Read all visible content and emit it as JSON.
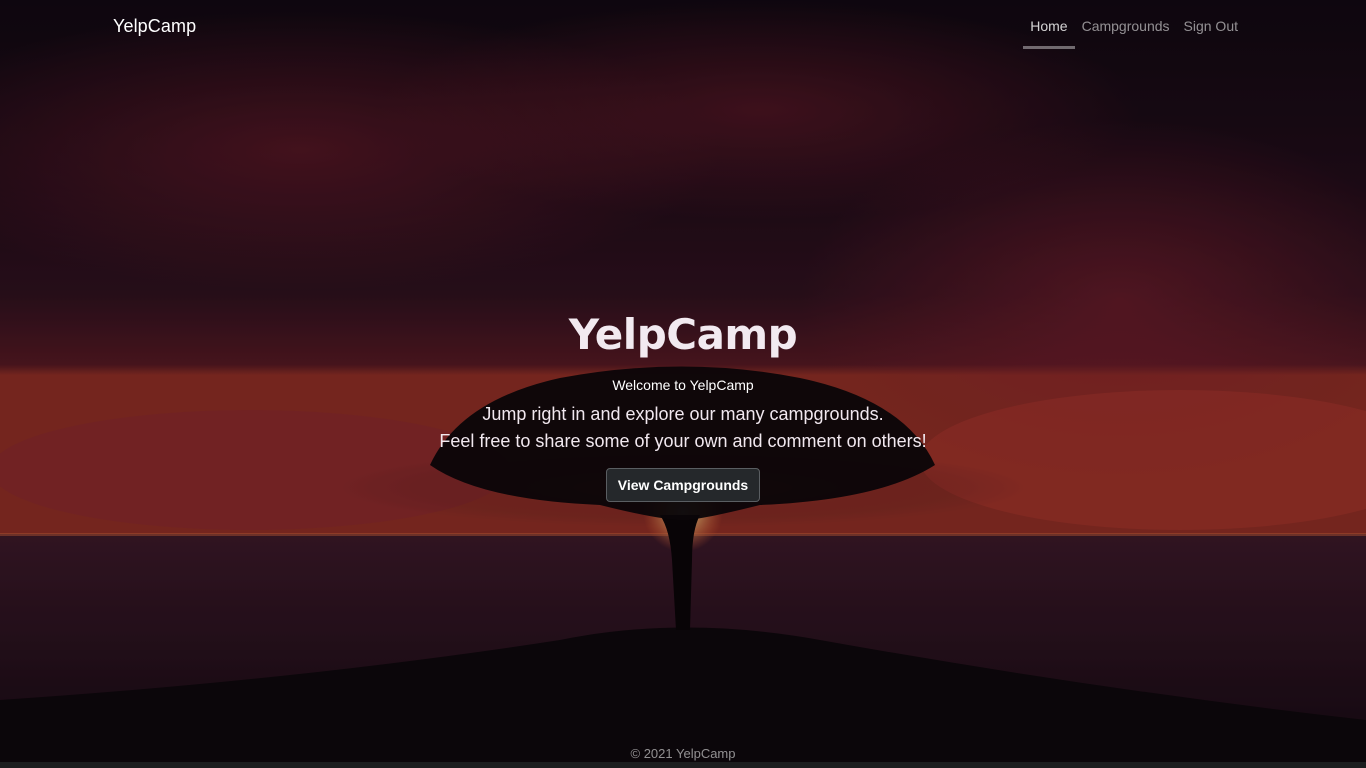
{
  "header": {
    "brand": "YelpCamp",
    "nav": [
      {
        "label": "Home",
        "active": true
      },
      {
        "label": "Campgrounds",
        "active": false
      },
      {
        "label": "Sign Out",
        "active": false
      }
    ]
  },
  "hero": {
    "title": "YelpCamp",
    "welcome": "Welcome to YelpCamp",
    "lead_line1": "Jump right in and explore our many campgrounds.",
    "lead_line2": "Feel free to share some of your own and comment on others!",
    "button_label": "View Campgrounds"
  },
  "footer": {
    "copyright": "© 2021 YelpCamp"
  },
  "colors": {
    "sky_top": "#1c0f1f",
    "sky_red": "#8a2233",
    "sun": "#ffd28a",
    "sea": "#2a1322",
    "button_bg": "#25282b"
  }
}
